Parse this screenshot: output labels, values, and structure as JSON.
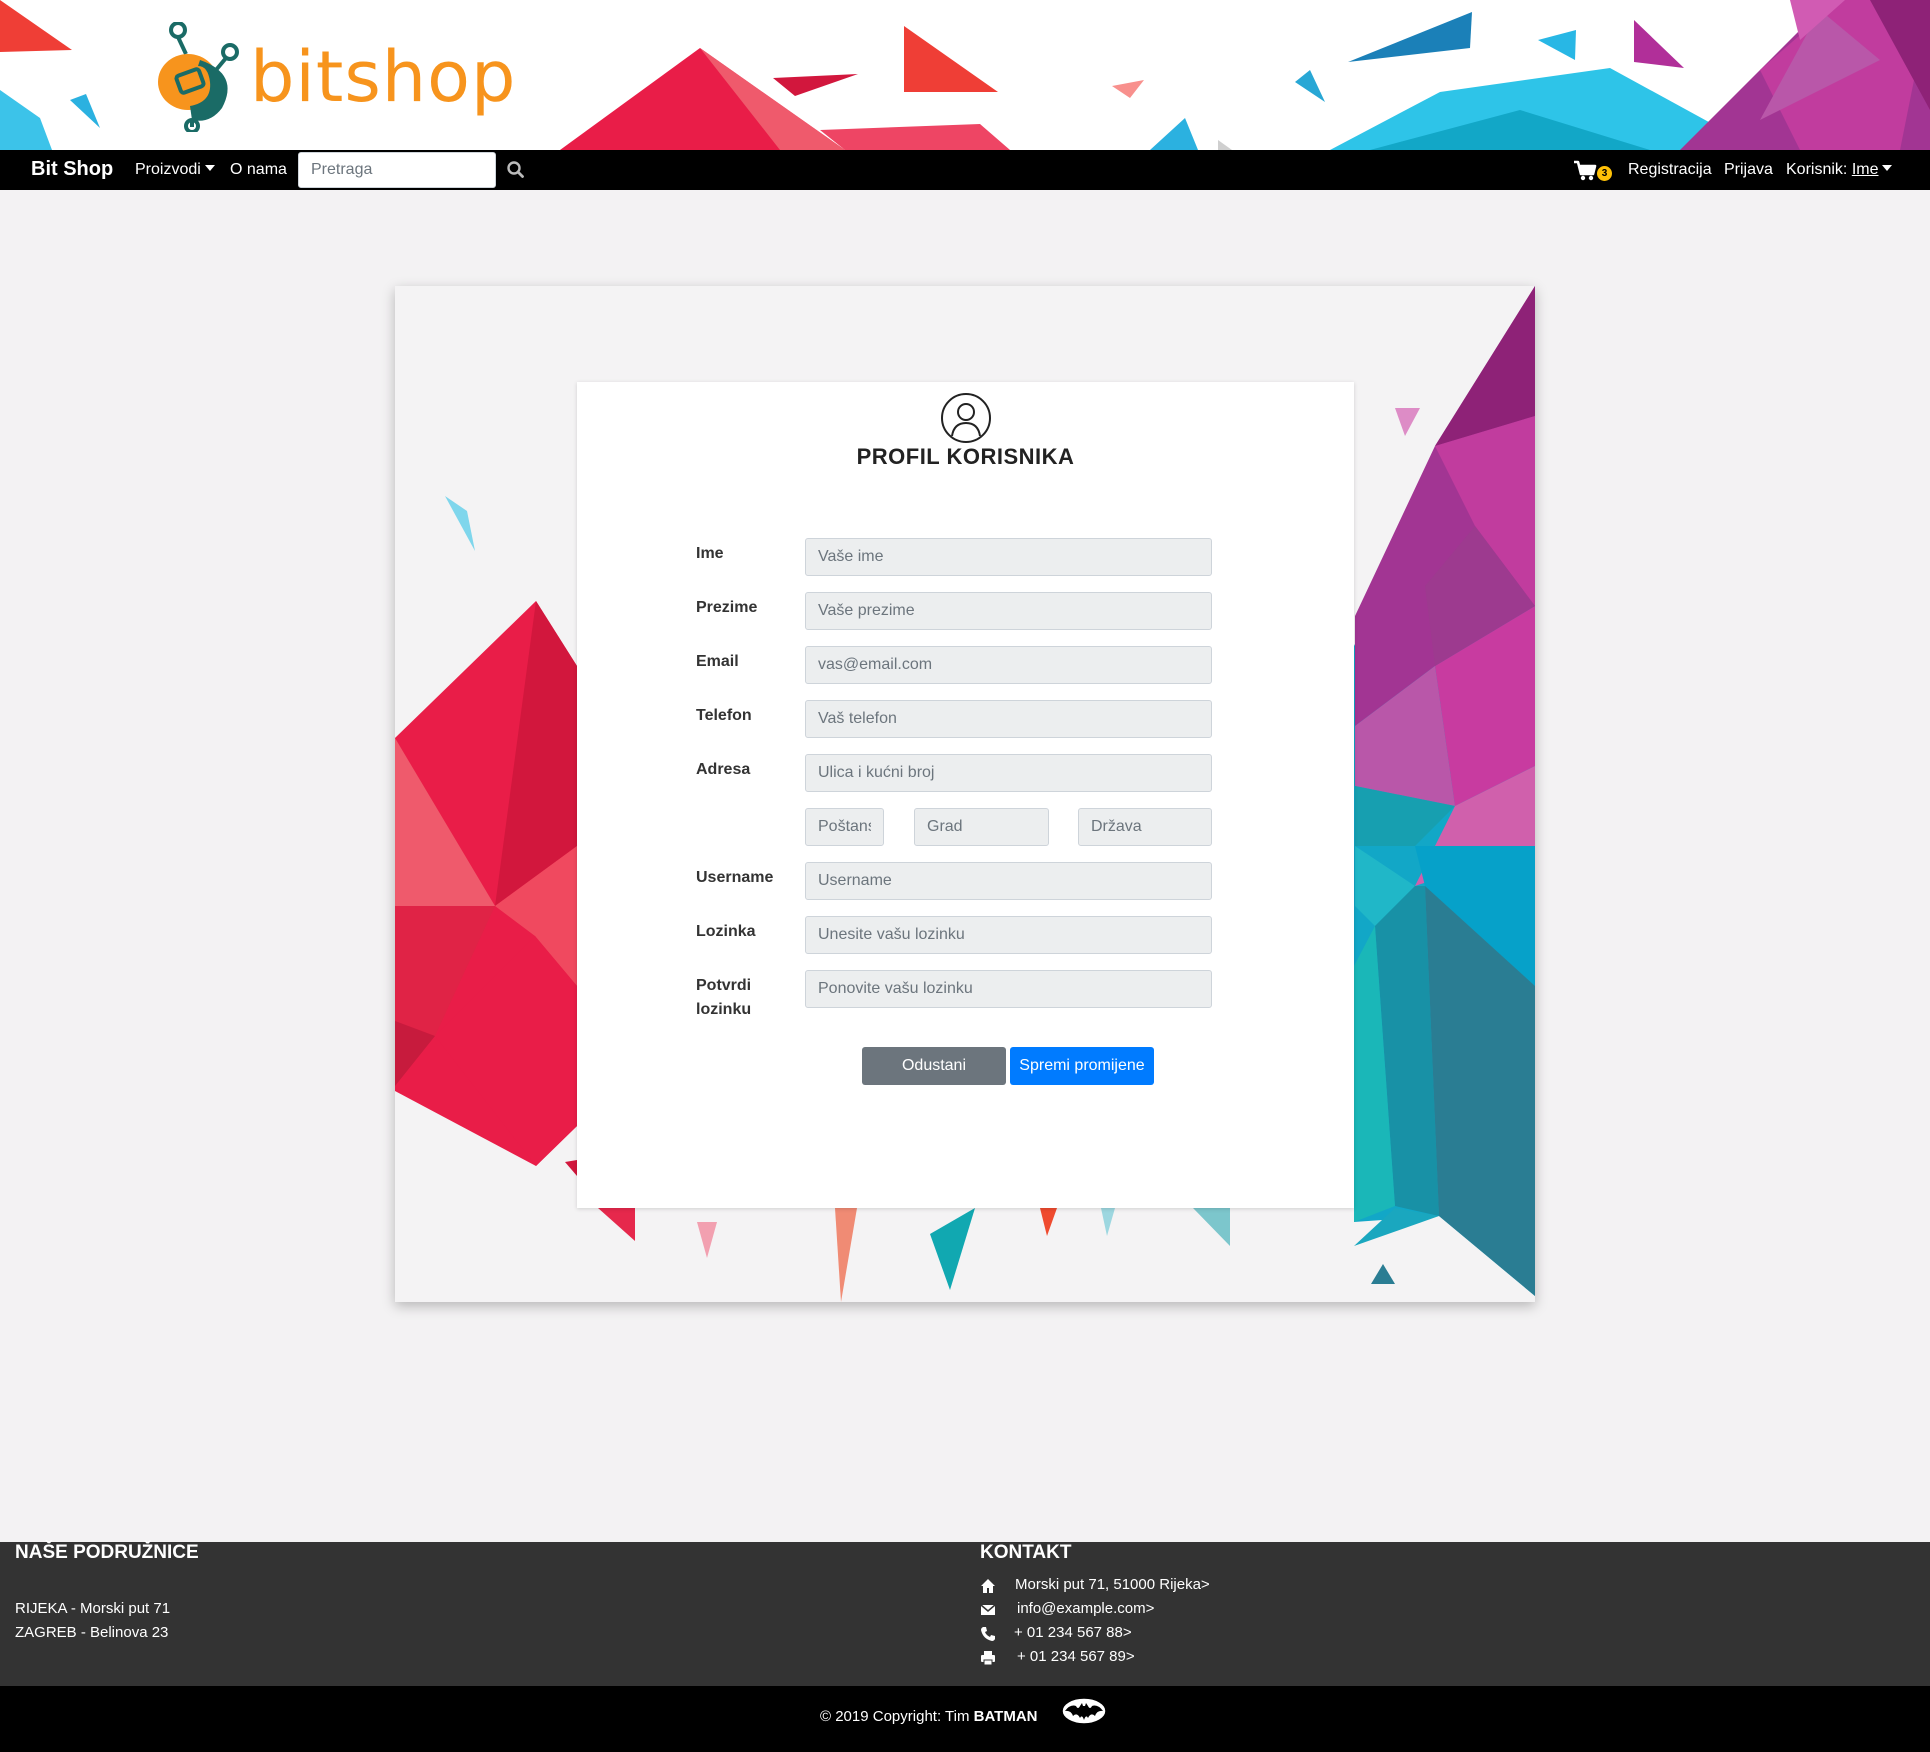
{
  "header": {
    "logo_text": "bitshop"
  },
  "navbar": {
    "brand": "Bit Shop",
    "products": "Proizvodi",
    "about": "O nama",
    "search_placeholder": "Pretraga",
    "cart_count": "3",
    "register": "Registracija",
    "login": "Prijava",
    "user_prefix": "Korisnik:",
    "user_name": "Ime"
  },
  "form": {
    "title": "PROFIL KORISNIKA",
    "fields": {
      "first_name": {
        "label": "Ime",
        "placeholder": "Vaše ime"
      },
      "last_name": {
        "label": "Prezime",
        "placeholder": "Vaše prezime"
      },
      "email": {
        "label": "Email",
        "placeholder": "vas@email.com"
      },
      "phone": {
        "label": "Telefon",
        "placeholder": "Vaš telefon"
      },
      "address": {
        "label": "Adresa",
        "placeholder": "Ulica i kućni broj"
      },
      "postal": {
        "placeholder": "Poštanski"
      },
      "city": {
        "placeholder": "Grad"
      },
      "country": {
        "placeholder": "Država"
      },
      "username": {
        "label": "Username",
        "placeholder": "Username"
      },
      "password": {
        "label": "Lozinka",
        "placeholder": "Unesite vašu lozinku"
      },
      "confirm": {
        "label_line1": "Potvrdi",
        "label_line2": "lozinku",
        "placeholder": "Ponovite vašu lozinku"
      }
    },
    "cancel_label": "Odustani",
    "save_label": "Spremi promijene"
  },
  "footer": {
    "branches_title": "NAŠE PODRUŽNICE",
    "branches": [
      "RIJEKA - Morski put 71",
      "ZAGREB - Belinova 23"
    ],
    "contact_title": "KONTAKT",
    "contact": {
      "address": "Morski put 71, 51000 Rijeka>",
      "email": "info@example.com>",
      "phone": "+ 01 234 567 88>",
      "fax": "+ 01 234 567 89>"
    },
    "copyright": "© 2019 Copyright: Tim",
    "team": "BATMAN"
  },
  "colors": {
    "brand_orange": "#f7941d",
    "logo_teal": "#1a6b66",
    "navbar": "#000000",
    "primary": "#007bff",
    "secondary": "#6c757d",
    "footer": "#333333",
    "badge": "#ffc107"
  },
  "icons": [
    "robot-logo-icon",
    "caret-down-icon",
    "search-icon",
    "cart-icon",
    "user-profile-icon",
    "home-icon",
    "envelope-icon",
    "phone-icon",
    "print-icon",
    "batman-icon"
  ]
}
